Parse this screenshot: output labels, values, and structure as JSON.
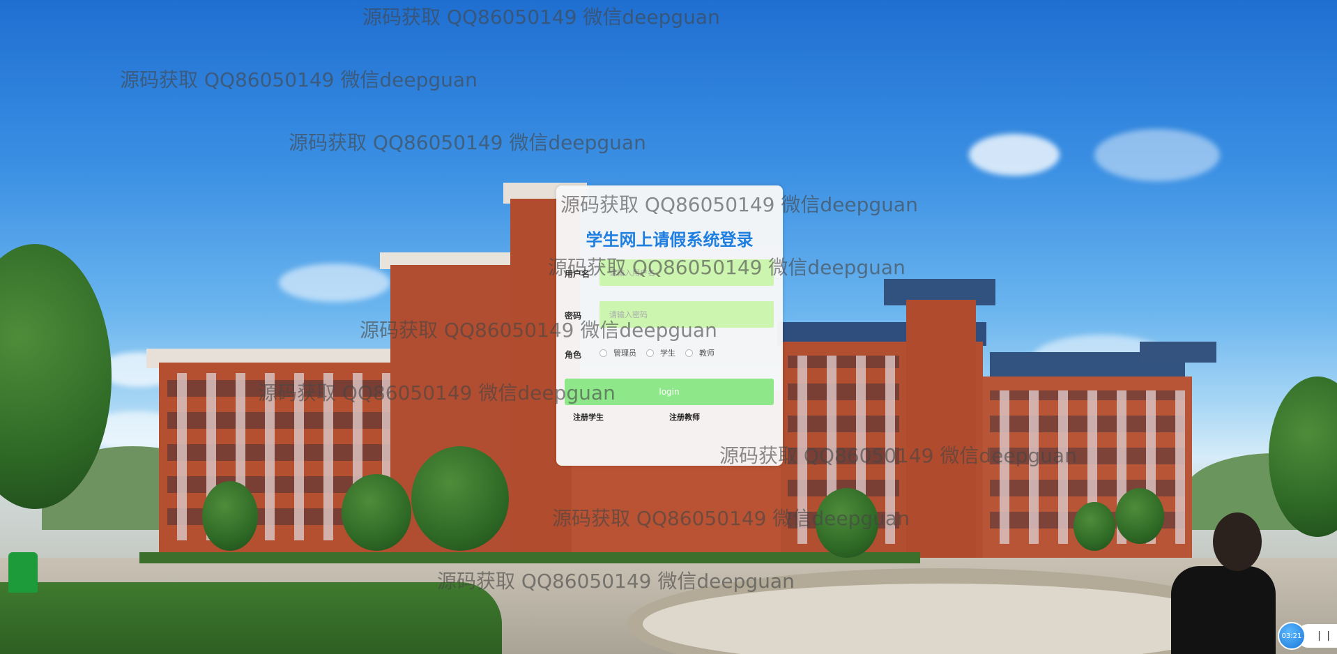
{
  "watermark": "源码获取 QQ86050149 微信deepguan",
  "login": {
    "title": "学生网上请假系统登录",
    "username_label": "用户名",
    "username_placeholder": "请输入用户名",
    "password_label": "密码",
    "password_placeholder": "请输入密码",
    "role_label": "角色",
    "roles": [
      "管理员",
      "学生",
      "教师"
    ],
    "login_button": "login",
    "register_student": "注册学生",
    "register_teacher": "注册教师"
  },
  "timer": {
    "time": "03:21",
    "control": "| |"
  }
}
